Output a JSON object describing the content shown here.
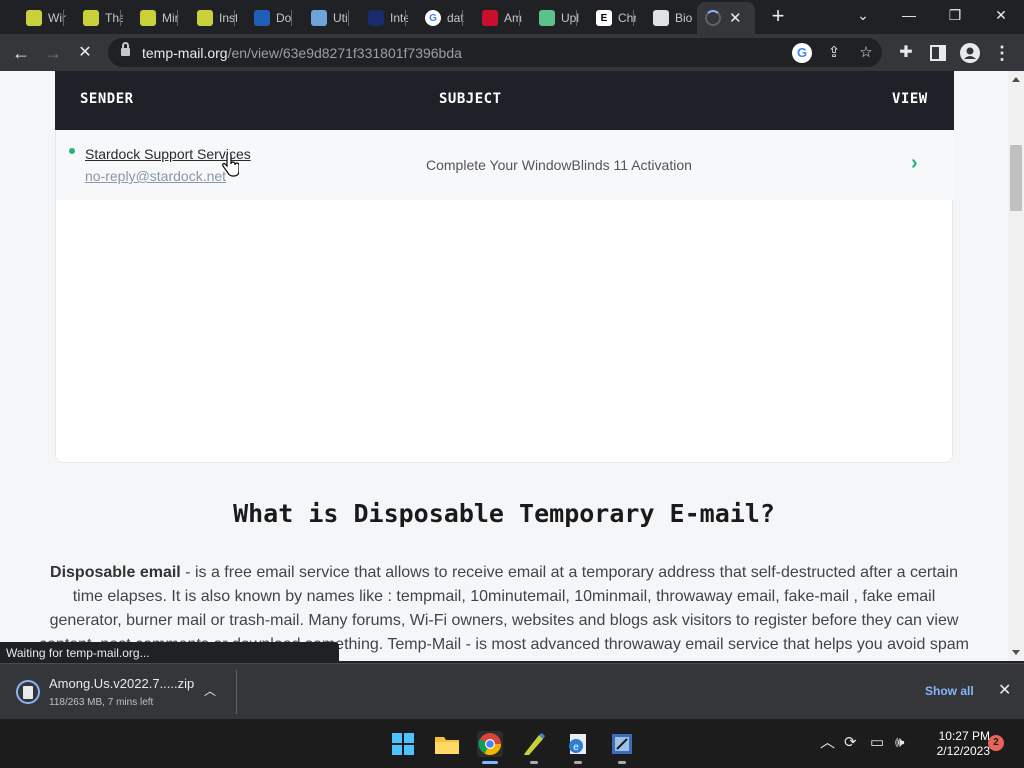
{
  "tabs": [
    {
      "title": "Wir",
      "icon": "pencil-icon",
      "color": "#c9d13a"
    },
    {
      "title": "Tha",
      "icon": "pencil-icon",
      "color": "#c9d13a"
    },
    {
      "title": "Mir",
      "icon": "pencil-icon",
      "color": "#c9d13a"
    },
    {
      "title": "Inst",
      "icon": "pencil-icon",
      "color": "#c9d13a"
    },
    {
      "title": "Do",
      "icon": "star-icon",
      "color": "#1f5fb5"
    },
    {
      "title": "Uti",
      "icon": "globe-icon",
      "color": "#6fa3d8"
    },
    {
      "title": "Inte",
      "icon": "logo-icon",
      "color": "#1a2a6c"
    },
    {
      "title": "dat",
      "icon": "google-icon",
      "color": "#ffffff"
    },
    {
      "title": "Am",
      "icon": "among-us-icon",
      "color": "#c8102e"
    },
    {
      "title": "Upl",
      "icon": "cloud-icon",
      "color": "#5cc18a"
    },
    {
      "title": "Chr",
      "icon": "e-icon",
      "color": "#ffffff"
    },
    {
      "title": "Bio",
      "icon": "card-icon",
      "color": "#dfe1e5"
    }
  ],
  "url": {
    "domain": "temp-mail.org",
    "path": "/en/view/63e9d8271f331801f7396bda"
  },
  "inbox": {
    "headers": {
      "sender": "SENDER",
      "subject": "SUBJECT",
      "view": "VIEW"
    },
    "messages": [
      {
        "sender_name": "Stardock Support Services",
        "sender_email": "no-reply@stardock.net",
        "subject": "Complete Your WindowBlinds 11 Activation"
      }
    ]
  },
  "faq": {
    "title": "What is Disposable Temporary E-mail?",
    "lead": "Disposable email",
    "body": " - is a free email service that allows to receive email at a temporary address that self-destructed after a certain time elapses. It is also known by names like : tempmail, 10minutemail, 10minmail, throwaway email, fake-mail , fake email generator, burner mail or trash-mail. Many forums, Wi-Fi owners, websites and blogs ask visitors to register before they can view content, post comments or download something. Temp-Mail - is most advanced throwaway email service that helps you avoid spam and stay safe."
  },
  "status_text": "Waiting for temp-mail.org...",
  "download": {
    "filename": "Among.Us.v2022.7.....zip",
    "progress": "118/263 MB, 7 mins left",
    "show_all": "Show all"
  },
  "taskbar": {
    "time": "10:27 PM",
    "date": "2/12/2023",
    "notifications": "2"
  },
  "colors": {
    "accent_green": "#22b573",
    "inbox_header": "#1f2129",
    "link_blue": "#8ab4f8"
  }
}
